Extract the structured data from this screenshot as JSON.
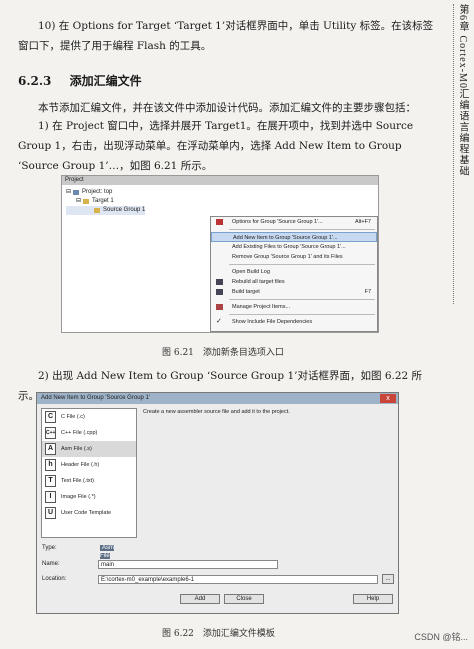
{
  "side_header": "第6章 Cortex-M0汇编语言编程基础",
  "paragraphs": {
    "p1": "10) 在 Options for Target ‘Target 1’对话框界面中，单击 Utility 标签。在该标签窗口下，提供了用于编程 Flash 的工具。",
    "heading_num": "6.2.3",
    "heading_title": "添加汇编文件",
    "p2": "本节添加汇编文件，并在该文件中添加设计代码。添加汇编文件的主要步骤包括：",
    "p3": "1) 在 Project 窗口中，选择并展开 Target1。在展开项中，找到并选中 Source Group 1，右击，出现浮动菜单。在浮动菜单内，选择 Add New Item to Group ‘Source Group 1’…，如图 6.21 所示。",
    "caption1": "图 6.21　添加新条目选项入口",
    "p4": "2) 出现 Add New Item to Group ‘Source Group 1’对话框界面，如图 6.22 所示。",
    "caption2": "图 6.22　添加汇编文件模板"
  },
  "fig1": {
    "window_title": "Project",
    "tree": [
      "Project: top",
      "Target 1",
      "Source Group 1"
    ],
    "menu": [
      {
        "label": "Options for Group 'Source Group 1'...",
        "shortcut": "Alt+F7"
      },
      {
        "label": "Add New Item to Group 'Source Group 1'...",
        "shortcut": ""
      },
      {
        "label": "Add Existing Files to Group 'Source Group 1'...",
        "shortcut": ""
      },
      {
        "label": "Remove Group 'Source Group 1' and its Files",
        "shortcut": ""
      },
      {
        "label": "Open Build Log",
        "shortcut": ""
      },
      {
        "label": "Rebuild all target files",
        "shortcut": ""
      },
      {
        "label": "Build target",
        "shortcut": "F7"
      },
      {
        "label": "Manage Project Items...",
        "shortcut": ""
      },
      {
        "label": "Show Include File Dependencies",
        "shortcut": ""
      }
    ]
  },
  "dialog": {
    "title": "Add New Item to Group 'Source Group 1'",
    "close": "x",
    "description": "Create a new assembler source file and add it to the project.",
    "types": [
      {
        "icon": "C",
        "label": "C File (.c)"
      },
      {
        "icon": "C++",
        "label": "C++ File (.cpp)"
      },
      {
        "icon": "A",
        "label": "Asm File (.s)"
      },
      {
        "icon": "h",
        "label": "Header File (.h)"
      },
      {
        "icon": "T",
        "label": "Text File (.txt)"
      },
      {
        "icon": "I",
        "label": "Image File (.*)"
      },
      {
        "icon": "U",
        "label": "User Code Template"
      }
    ],
    "type_label": "Type:",
    "type_value": "Asm File (.s)",
    "name_label": "Name:",
    "name_value": "main",
    "location_label": "Location:",
    "location_value": "E:\\cortex-m0_example\\example6-1",
    "browse": "...",
    "add": "Add",
    "close_btn": "Close",
    "help": "Help"
  },
  "watermark": "CSDN @铭..."
}
